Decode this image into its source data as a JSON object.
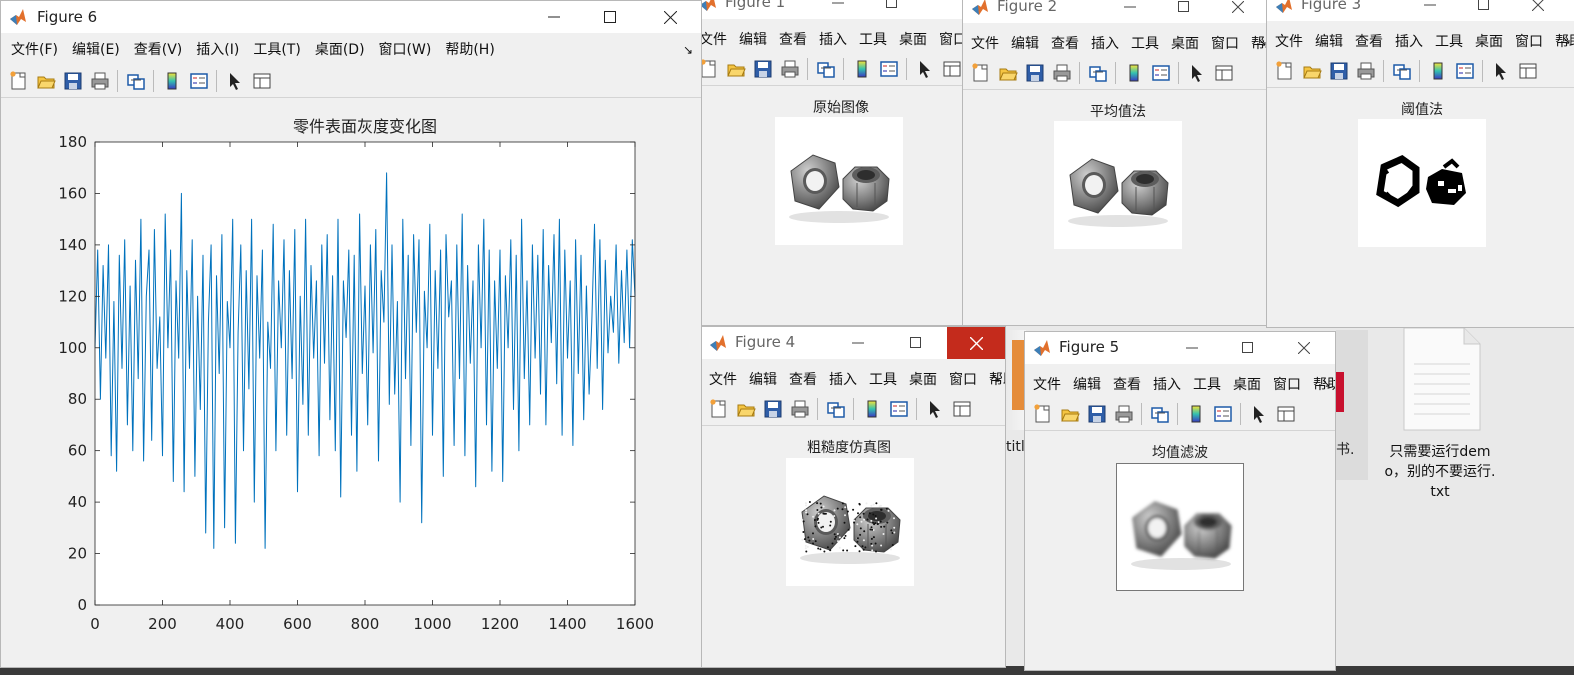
{
  "menu_full": [
    "文件(F)",
    "编辑(E)",
    "查看(V)",
    "插入(I)",
    "工具(T)",
    "桌面(D)",
    "窗口(W)",
    "帮助(H)"
  ],
  "menu_short": [
    "文件",
    "编辑",
    "查看",
    "插入",
    "工具",
    "桌面",
    "窗口",
    "帮助"
  ],
  "figure6": {
    "title": "Figure 6",
    "chart_data": {
      "type": "line",
      "title": "零件表面灰度变化图",
      "xlabel": "",
      "ylabel": "",
      "xlim": [
        0,
        1600
      ],
      "ylim": [
        0,
        180
      ],
      "xticks": [
        "0",
        "200",
        "400",
        "600",
        "800",
        "1000",
        "1200",
        "1400",
        "1600"
      ],
      "yticks": [
        "0",
        "20",
        "40",
        "60",
        "80",
        "100",
        "120",
        "140",
        "160",
        "180"
      ],
      "grid": false,
      "series": [
        {
          "color": "#0072bd",
          "x": [
            0,
            8,
            16,
            24,
            32,
            40,
            48,
            56,
            64,
            72,
            80,
            88,
            96,
            104,
            112,
            120,
            128,
            136,
            144,
            152,
            160,
            168,
            176,
            184,
            192,
            200,
            208,
            216,
            224,
            232,
            240,
            248,
            256,
            264,
            272,
            280,
            288,
            296,
            304,
            312,
            320,
            328,
            336,
            344,
            352,
            360,
            368,
            376,
            384,
            392,
            400,
            408,
            416,
            424,
            432,
            440,
            448,
            456,
            464,
            472,
            480,
            488,
            496,
            504,
            512,
            520,
            528,
            536,
            544,
            552,
            560,
            568,
            576,
            584,
            592,
            600,
            608,
            616,
            624,
            632,
            640,
            648,
            656,
            664,
            672,
            680,
            688,
            696,
            704,
            712,
            720,
            728,
            736,
            744,
            752,
            760,
            768,
            776,
            784,
            792,
            800,
            808,
            816,
            824,
            832,
            840,
            848,
            856,
            864,
            872,
            880,
            888,
            896,
            904,
            912,
            920,
            928,
            936,
            944,
            952,
            960,
            968,
            976,
            984,
            992,
            1000,
            1008,
            1016,
            1024,
            1032,
            1040,
            1048,
            1056,
            1064,
            1072,
            1080,
            1088,
            1096,
            1104,
            1112,
            1120,
            1128,
            1136,
            1144,
            1152,
            1160,
            1168,
            1176,
            1184,
            1192,
            1200,
            1208,
            1216,
            1224,
            1232,
            1240,
            1248,
            1256,
            1264,
            1272,
            1280,
            1288,
            1296,
            1304,
            1312,
            1320,
            1328,
            1336,
            1344,
            1352,
            1360,
            1368,
            1376,
            1384,
            1392,
            1400,
            1408,
            1416,
            1424,
            1432,
            1440,
            1448,
            1456,
            1464,
            1472,
            1480,
            1488,
            1496,
            1504,
            1512,
            1520,
            1528,
            1536,
            1544,
            1552,
            1560,
            1568,
            1576,
            1584,
            1592,
            1600
          ],
          "y": [
            100,
            138,
            80,
            132,
            96,
            140,
            58,
            118,
            52,
            136,
            92,
            142,
            70,
            124,
            60,
            134,
            88,
            150,
            56,
            120,
            138,
            64,
            146,
            92,
            112,
            58,
            152,
            100,
            138,
            48,
            126,
            96,
            160,
            44,
            130,
            92,
            142,
            50,
            120,
            76,
            136,
            28,
            110,
            140,
            22,
            128,
            90,
            144,
            30,
            118,
            100,
            150,
            24,
            106,
            140,
            60,
            130,
            84,
            150,
            40,
            128,
            96,
            138,
            22,
            110,
            92,
            148,
            60,
            126,
            100,
            142,
            66,
            130,
            88,
            146,
            44,
            120,
            78,
            150,
            66,
            132,
            96,
            126,
            58,
            140,
            94,
            144,
            72,
            128,
            60,
            150,
            42,
            126,
            104,
            138,
            66,
            136,
            52,
            152,
            90,
            124,
            70,
            140,
            98,
            146,
            56,
            130,
            110,
            168,
            78,
            140,
            82,
            118,
            40,
            150,
            88,
            136,
            62,
            144,
            106,
            142,
            32,
            122,
            100,
            148,
            66,
            130,
            92,
            138,
            50,
            144,
            112,
            126,
            62,
            140,
            88,
            152,
            58,
            132,
            94,
            126,
            46,
            140,
            100,
            150,
            70,
            138,
            52,
            126,
            92,
            138,
            48,
            128,
            100,
            142,
            76,
            136,
            60,
            150,
            88,
            126,
            70,
            140,
            96,
            136,
            82,
            146,
            70,
            132,
            102,
            144,
            86,
            150,
            66,
            138,
            96,
            126,
            62,
            142,
            90,
            136,
            72,
            124,
            82,
            110,
            148,
            92,
            142,
            76,
            134,
            98,
            120,
            106,
            140,
            94,
            130,
            102,
            138,
            100,
            142,
            120
          ]
        }
      ]
    }
  },
  "figure1": {
    "title": "Figure 1",
    "caption": "原始图像"
  },
  "figure2": {
    "title": "Figure 2",
    "caption": "平均值法"
  },
  "figure3": {
    "title": "Figure 3",
    "caption": "阈值法"
  },
  "figure4": {
    "title": "Figure 4",
    "caption": "粗糙度仿真图"
  },
  "figure5": {
    "title": "Figure 5",
    "caption": "均值滤波"
  },
  "desktop": {
    "file_label": "只需要运行demo，别的不要运行.txt",
    "partial_label_1": "titl",
    "partial_label_2": "书."
  }
}
